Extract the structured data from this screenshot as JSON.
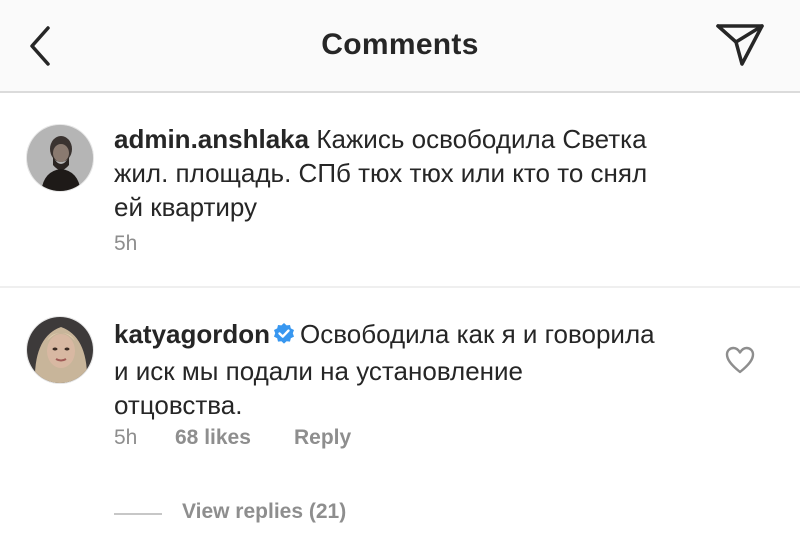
{
  "header": {
    "title": "Comments"
  },
  "comments": [
    {
      "username": "admin.anshlaka",
      "line1": "Кажись освободила Светка",
      "line2": "жил. площадь. СПб тюх тюх или кто то снял",
      "line3": "ей квартиру",
      "time": "5h"
    },
    {
      "username": "katyagordon",
      "verified": true,
      "line1": "Освободила как я и говорила",
      "line2": "и иск мы подали на установление",
      "line3": "отцовства.",
      "time": "5h",
      "likes": "68 likes",
      "reply_label": "Reply",
      "view_replies": "View replies (21)"
    }
  ],
  "colors": {
    "text": "#262626",
    "meta": "#8e8e8e",
    "verified": "#3897f0",
    "divider": "#efefef"
  }
}
